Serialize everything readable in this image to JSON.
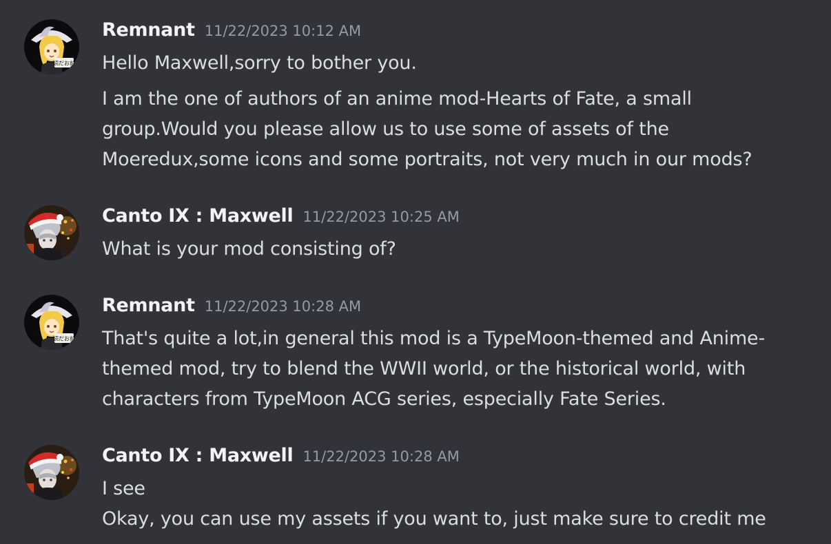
{
  "messages": [
    {
      "author": "Remnant",
      "timestamp": "11/22/2023 10:12 AM",
      "avatar_icon": "blonde-witch-avatar-icon",
      "lines": [
        "Hello Maxwell,sorry to bother you.",
        "I am the one of authors of an anime mod-Hearts of Fate, a small",
        "group.Would you please allow us to use some of assets of the",
        "Moeredux,some icons and some portraits, not very much in our mods?"
      ]
    },
    {
      "author": "Canto IX : Maxwell",
      "timestamp": "11/22/2023 10:25 AM",
      "avatar_icon": "santa-hat-avatar-icon",
      "lines": [
        "What is your mod consisting of?"
      ]
    },
    {
      "author": "Remnant",
      "timestamp": "11/22/2023 10:28 AM",
      "avatar_icon": "blonde-witch-avatar-icon",
      "lines": [
        "That's quite a lot,in general this mod is a TypeMoon-themed and Anime-",
        "themed mod, try to blend the WWII world, or the historical world, with",
        "characters from TypeMoon ACG series, especially Fate Series."
      ]
    },
    {
      "author": "Canto IX : Maxwell",
      "timestamp": "11/22/2023 10:28 AM",
      "avatar_icon": "santa-hat-avatar-icon",
      "lines": [
        "I see",
        "Okay, you can use my assets if you want to, just make sure to credit me"
      ]
    }
  ],
  "avatar_badge_text": "読だお前",
  "colors": {
    "background": "#313338",
    "username": "#f2f3f5",
    "timestamp": "#949ba4",
    "message_text": "#dbdee1"
  }
}
